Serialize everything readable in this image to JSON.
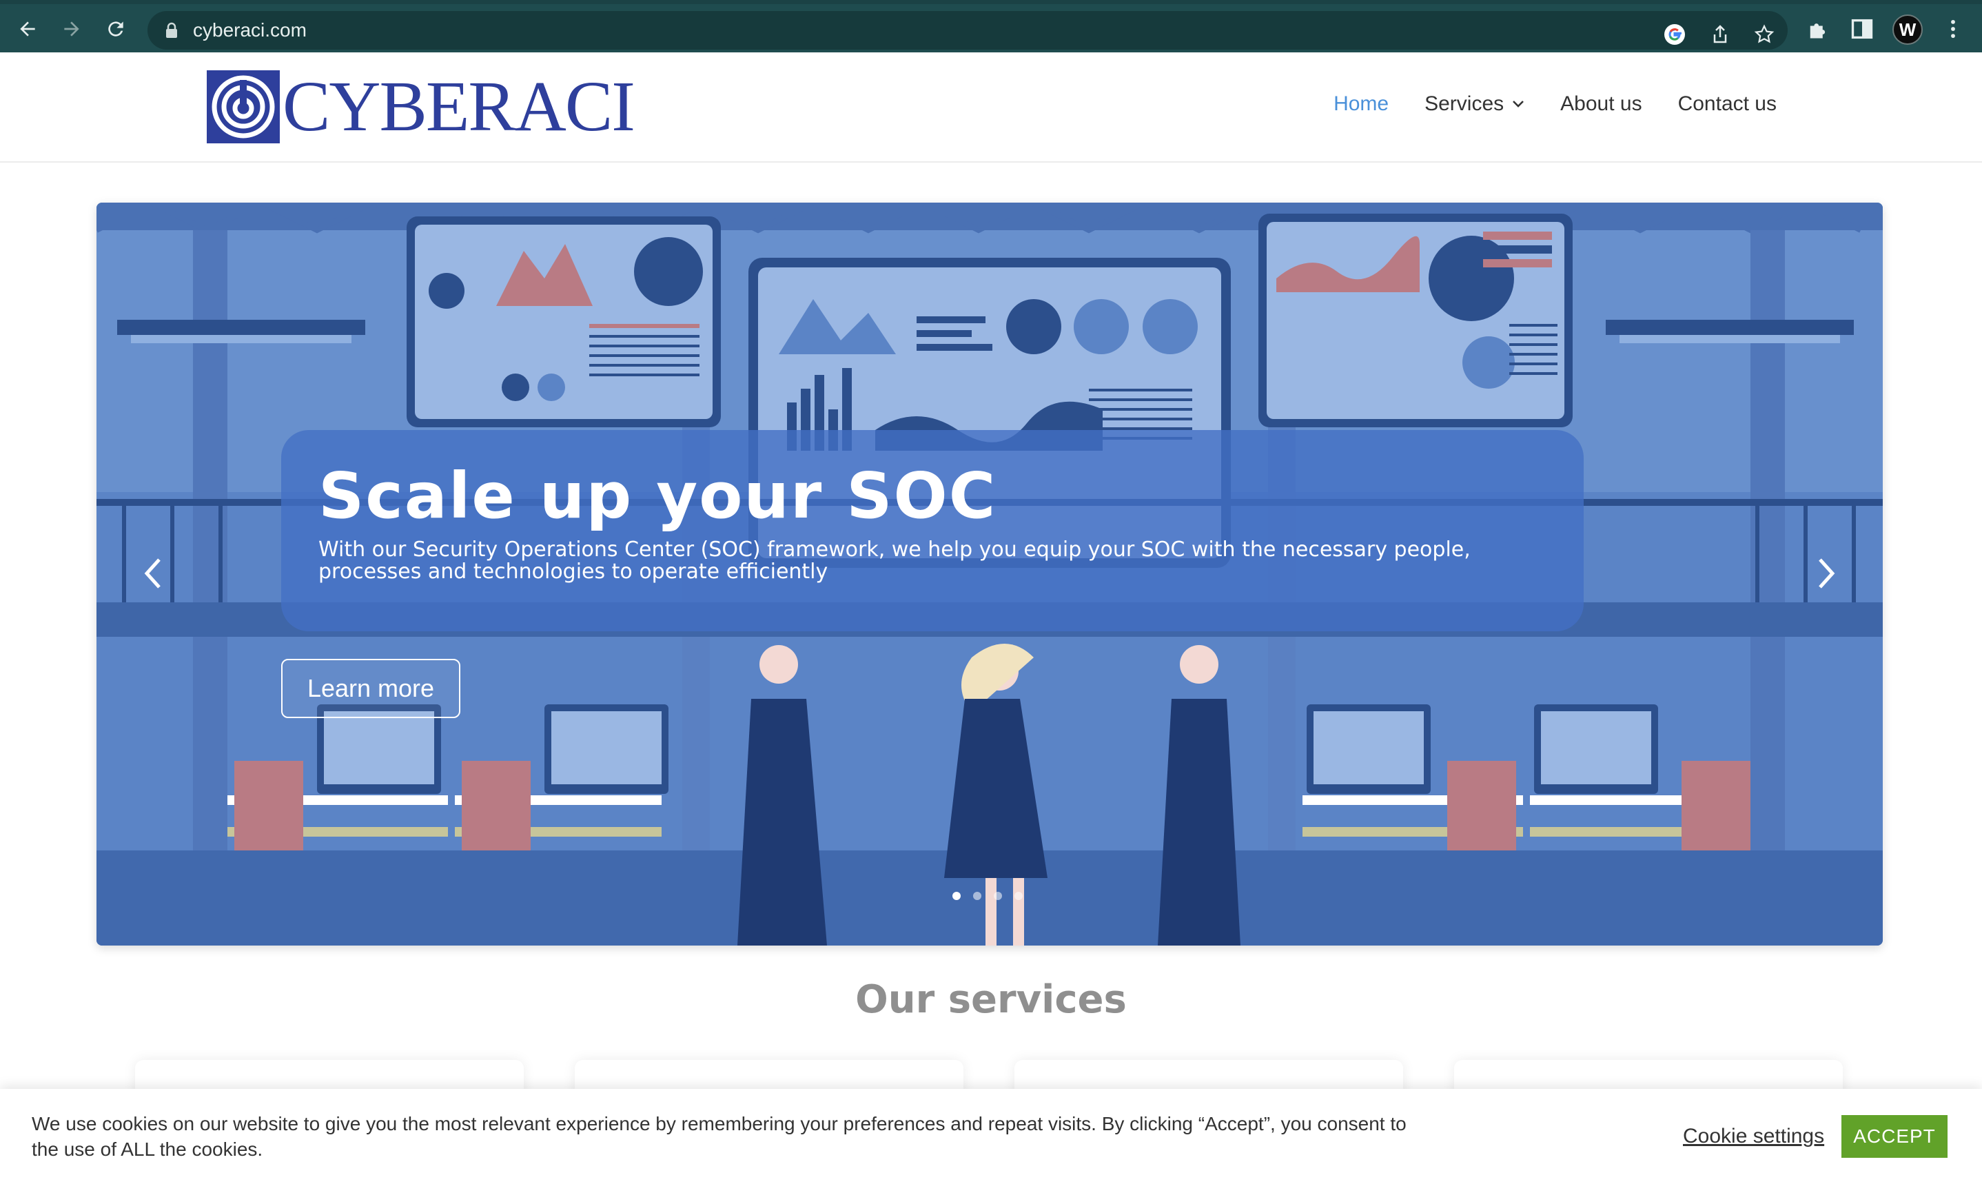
{
  "browser": {
    "url": "cyberaci.com",
    "icons": [
      "back-icon",
      "forward-icon",
      "reload-icon",
      "lock-icon",
      "google-icon",
      "share-icon",
      "bookmark-star-icon",
      "extensions-icon",
      "side-panel-icon",
      "profile-avatar",
      "more-menu-icon"
    ],
    "profile_initial": "W",
    "chrome_color": "#1f4c4f"
  },
  "header": {
    "logo_text": "CYBERACI",
    "brand_color": "#2e3f9c",
    "nav": [
      {
        "label": "Home",
        "active": true
      },
      {
        "label": "Services",
        "has_dropdown": true
      },
      {
        "label": "About us"
      },
      {
        "label": "Contact us"
      }
    ],
    "active_color": "#4a90d9"
  },
  "hero": {
    "title": "Scale up your SOC",
    "subtitle": "With our Security Operations Center (SOC) framework, we help you equip your SOC with the necessary people, processes and technologies to operate efficiently",
    "cta_label": "Learn more",
    "slide_count": 4,
    "active_slide": 1
  },
  "services": {
    "title": "Our services"
  },
  "cookie_bar": {
    "text": "We use cookies on our website to give you the most relevant experience by remembering your preferences and repeat visits. By clicking “Accept”, you consent to the use of ALL the cookies.",
    "settings_label": "Cookie settings",
    "accept_label": "ACCEPT",
    "accept_color": "#61a229"
  }
}
